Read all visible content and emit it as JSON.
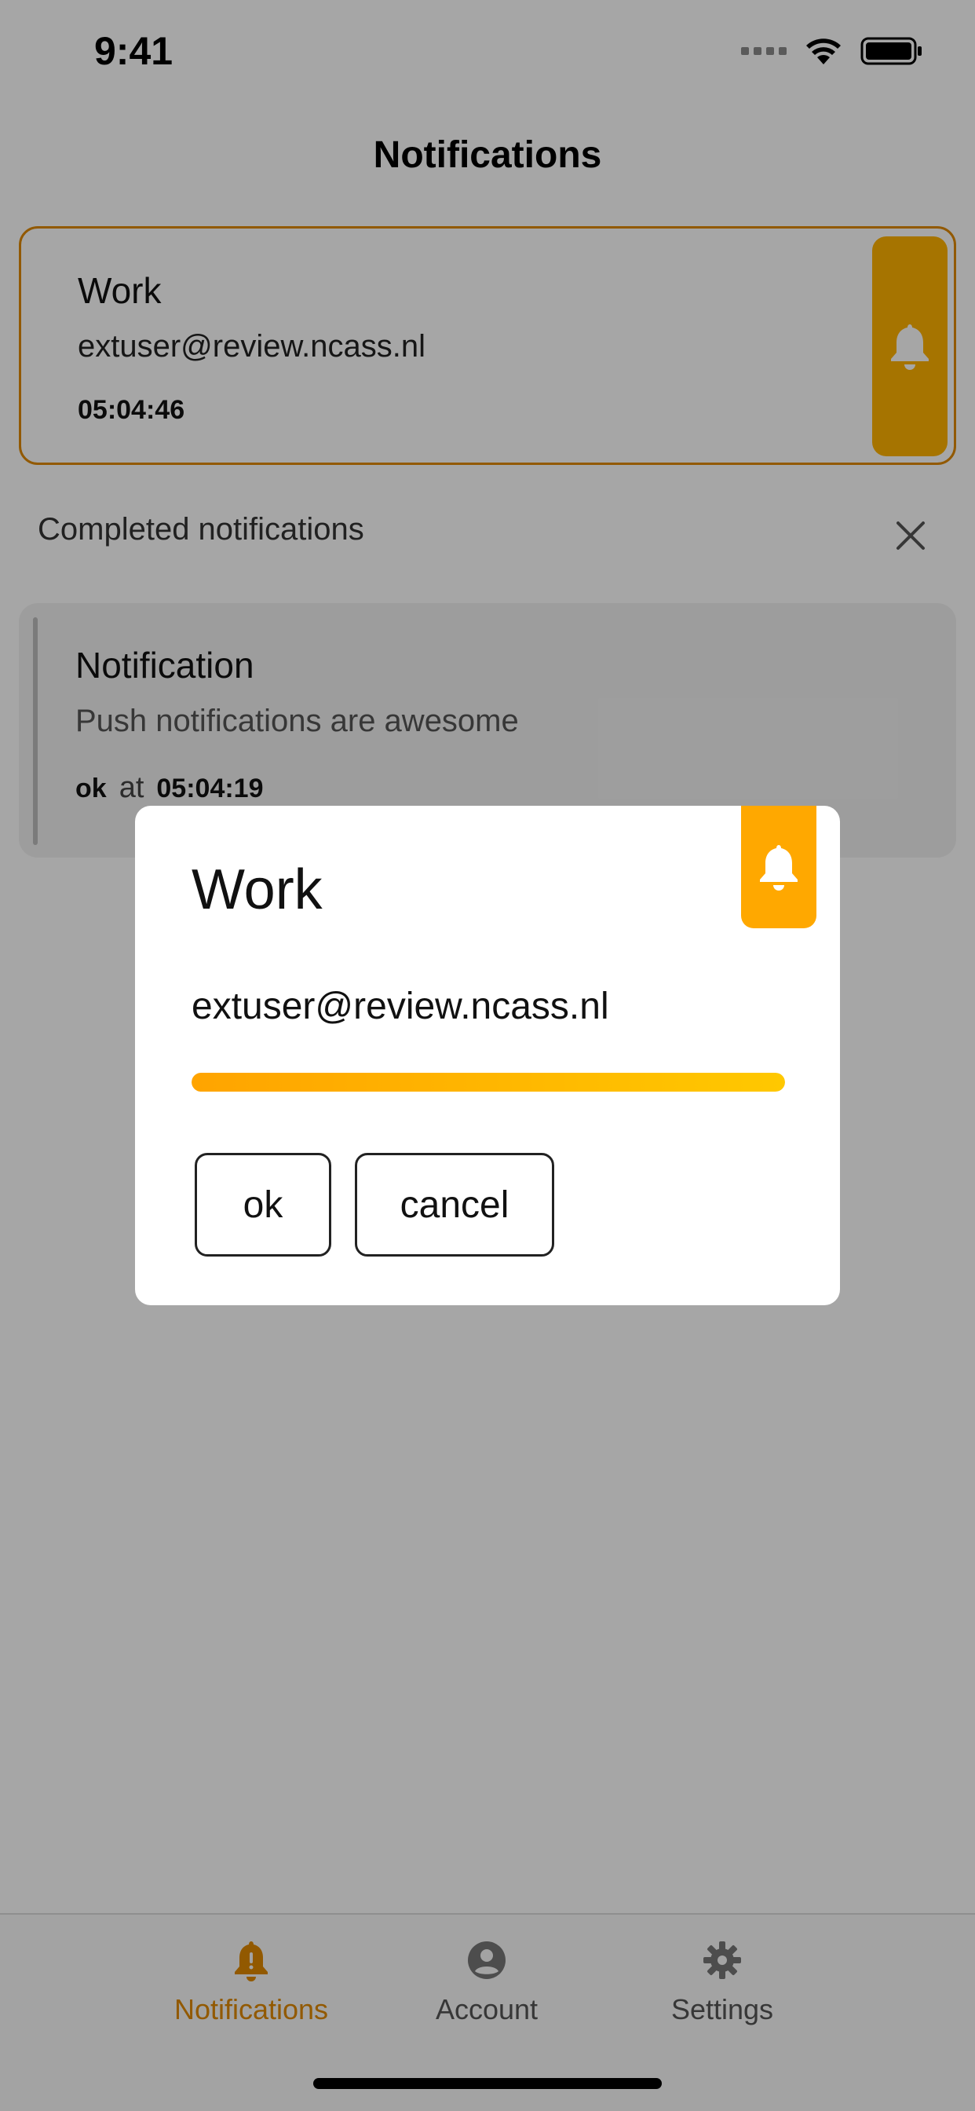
{
  "status_bar": {
    "time": "9:41"
  },
  "header": {
    "title": "Notifications"
  },
  "active_notification": {
    "title": "Work",
    "email": "extuser@review.ncass.nl",
    "time": "05:04:46"
  },
  "completed": {
    "label": "Completed notifications",
    "items": [
      {
        "title": "Notification",
        "body": "Push notifications are awesome",
        "answer": "ok",
        "at": "at",
        "time": "05:04:19"
      }
    ]
  },
  "dialog": {
    "title": "Work",
    "email": "extuser@review.ncass.nl",
    "progress_fraction": 1.0,
    "ok_label": "ok",
    "cancel_label": "cancel"
  },
  "tabbar": {
    "items": [
      {
        "label": "Notifications",
        "icon": "bell-icon",
        "active": true
      },
      {
        "label": "Account",
        "icon": "user-circle-icon",
        "active": false
      },
      {
        "label": "Settings",
        "icon": "gear-icon",
        "active": false
      }
    ]
  },
  "colors": {
    "accent": "#e08900",
    "bell_tab": "#ffb300",
    "progress_start": "#ffa400",
    "progress_end": "#ffc800"
  }
}
